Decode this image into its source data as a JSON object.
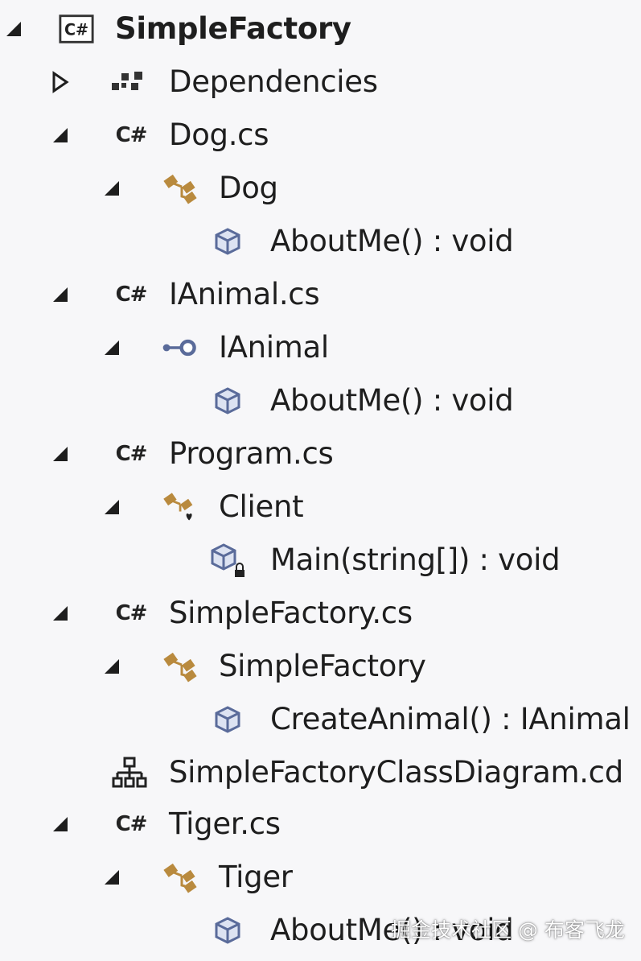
{
  "tree": {
    "project": {
      "label": "SimpleFactory",
      "icon": "csharp-project-icon"
    },
    "dependencies": {
      "label": "Dependencies",
      "icon": "dependencies-icon"
    },
    "files": [
      {
        "name": "Dog.cs",
        "class": "Dog",
        "class_icon": "class-icon",
        "members": [
          {
            "label": "AboutMe() : void",
            "icon": "method-icon"
          }
        ]
      },
      {
        "name": "IAnimal.cs",
        "class": "IAnimal",
        "class_icon": "interface-icon",
        "members": [
          {
            "label": "AboutMe() : void",
            "icon": "method-icon"
          }
        ]
      },
      {
        "name": "Program.cs",
        "class": "Client",
        "class_icon": "internal-class-icon",
        "members": [
          {
            "label": "Main(string[]) : void",
            "icon": "private-method-icon"
          }
        ]
      },
      {
        "name": "SimpleFactory.cs",
        "class": "SimpleFactory",
        "class_icon": "class-icon",
        "members": [
          {
            "label": "CreateAnimal() : IAnimal",
            "icon": "method-icon"
          }
        ]
      },
      {
        "name": "Tiger.cs",
        "class": "Tiger",
        "class_icon": "class-icon",
        "members": [
          {
            "label": "AboutMe() : void",
            "icon": "method-icon"
          }
        ]
      }
    ],
    "diagram": {
      "label": "SimpleFactoryClassDiagram.cd",
      "icon": "class-diagram-icon"
    },
    "cs_glyph": "C#",
    "project_glyph": "C#"
  },
  "watermark": "掘金技术社区 @ 布客飞龙",
  "colors": {
    "class_icon": "#b98a3e",
    "method_icon": "#5a6b9a",
    "arrow": "#1e1e1e"
  }
}
